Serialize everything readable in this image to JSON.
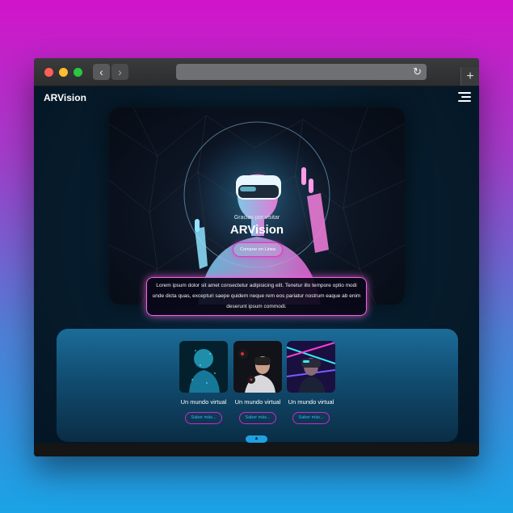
{
  "browser": {
    "back_icon": "‹",
    "forward_icon": "›",
    "reload_icon": "↻",
    "new_tab_icon": "+"
  },
  "nav": {
    "logo": "ARVision"
  },
  "hero": {
    "subtitle": "Gracias por visitar",
    "title": "ARVision",
    "cta_label": "Comprar en Linea",
    "description": "Lorem ipsum dolor sit amet consectetur adipisicing elit. Tenetur illo tempore optio modi unde dicta quas, excepturi saepe quidem neque rem eos pariatur nostrum eaque ab enim deserunt ipsum commodi."
  },
  "cards": [
    {
      "label": "Un mundo virtual",
      "button": "Saber más..."
    },
    {
      "label": "Un mundo virtual",
      "button": "Saber más..."
    },
    {
      "label": "Un mundo virtual",
      "button": "Saber más..."
    }
  ],
  "footer": {
    "up_icon": "▲"
  },
  "colors": {
    "accent_pink": "#e236c4",
    "accent_blue": "#1fa0e0",
    "page_bg": "#061b2b"
  }
}
